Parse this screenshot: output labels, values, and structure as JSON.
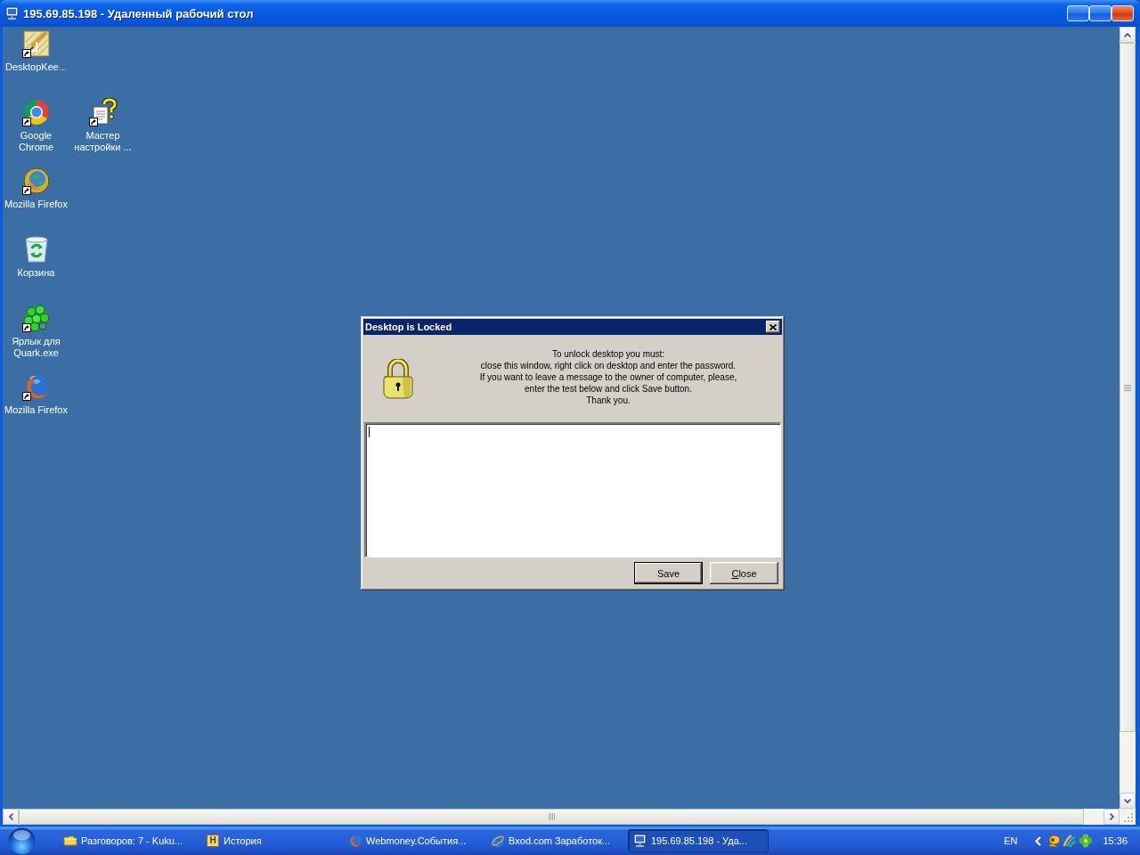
{
  "window": {
    "title": "195.69.85.198 - Удаленный рабочий стол"
  },
  "desktop": {
    "icon_rows": [
      {
        "icons": [
          {
            "label": "DesktopKee...",
            "kind": "pencil",
            "shortcut": true
          }
        ]
      },
      {
        "icons": [
          {
            "label": "Google Chrome",
            "kind": "ring",
            "shortcut": true
          },
          {
            "label": "Мастер настройки ...",
            "kind": "wizard",
            "shortcut": true
          }
        ]
      },
      {
        "icons": [
          {
            "label": "Mozilla Firefox",
            "kind": "globe",
            "shortcut": true
          }
        ]
      },
      {
        "icons": [
          {
            "label": "Корзина",
            "kind": "bin",
            "shortcut": false
          }
        ]
      },
      {
        "icons": [
          {
            "label": "Ярлык для Quark.exe",
            "kind": "cluster",
            "shortcut": true
          }
        ]
      },
      {
        "icons": [
          {
            "label": "Mozilla Firefox",
            "kind": "swirl",
            "shortcut": true
          }
        ]
      }
    ]
  },
  "dialog": {
    "title": "Desktop is Locked",
    "message_lines": [
      "To unlock desktop you must:",
      "close this window, right click on desktop and enter the password.",
      "If you want to leave a message to the owner of computer, please,",
      "enter the test below and click Save button.",
      "Thank you."
    ],
    "message_box": {
      "focused": true
    },
    "buttons": [
      {
        "label": "Save",
        "default": true,
        "mnemonic": false
      },
      {
        "label": "Close",
        "default": false,
        "mnemonic": true
      }
    ]
  },
  "taskbar": {
    "tasks": [
      {
        "label": "Разговоров: 7 - Kuku...",
        "kind": "folder",
        "selected": false
      },
      {
        "label": "История",
        "kind": "letter",
        "icon_text": "H",
        "selected": false
      },
      {
        "label": "Webmoney.События...",
        "kind": "swirl",
        "selected": false
      },
      {
        "label": "Bxod.com Заработок...",
        "kind": "orbit",
        "selected": false
      },
      {
        "label": "195.69.85.198 - Уда...",
        "kind": "monitor",
        "selected": true
      }
    ],
    "language": "EN",
    "clock": "15:36"
  }
}
